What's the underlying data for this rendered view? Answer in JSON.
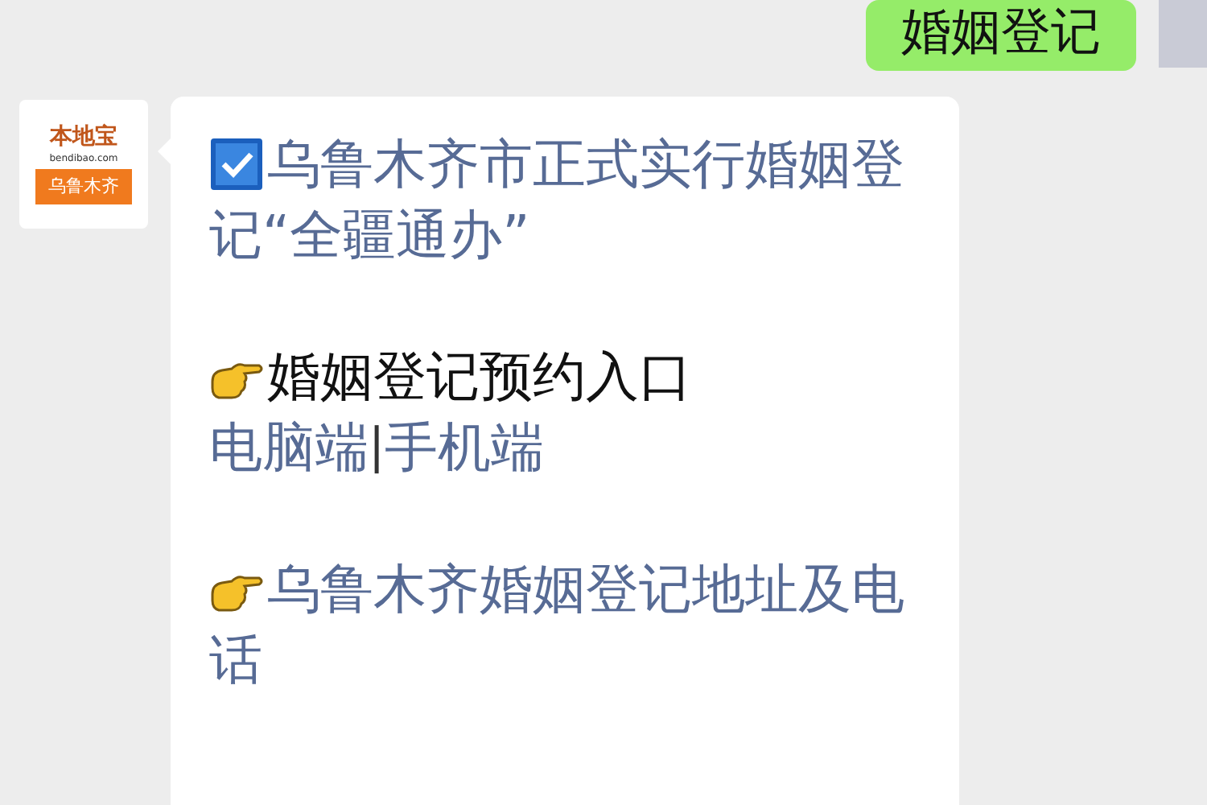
{
  "messages": [
    {
      "kind": "outgoing",
      "text": "婚姻登记"
    },
    {
      "kind": "incoming",
      "avatar": {
        "brand": "本地宝",
        "site": "bendibao.com",
        "city": "乌鲁木齐"
      },
      "blocks": [
        {
          "kind": "checked_link",
          "text": "乌鲁木齐市正式实行婚姻登记“全疆通办”"
        },
        {
          "kind": "pointing_heading",
          "text": "婚姻登记预约入口"
        },
        {
          "kind": "links",
          "separator": "|",
          "items": [
            "电脑端",
            "手机端"
          ]
        },
        {
          "kind": "pointing_link",
          "text": "乌鲁木齐婚姻登记地址及电话"
        }
      ]
    }
  ]
}
